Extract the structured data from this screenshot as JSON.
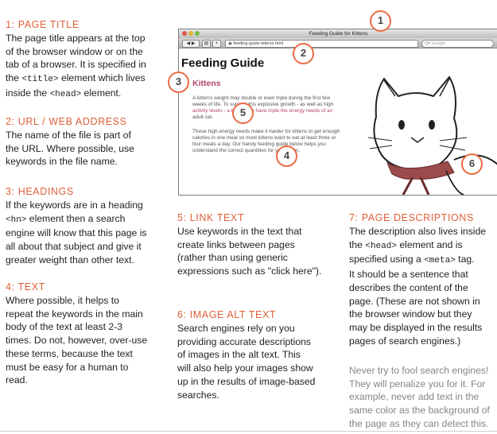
{
  "left": {
    "s1_heading": "1: PAGE TITLE",
    "s1_lines": [
      "The page title appears at the top",
      "of the browser window or on the",
      "tab of a browser. It is specified in"
    ],
    "s1_l4_pre": "the ",
    "s1_l4_code": "<title>",
    "s1_l4_post": " element which lives",
    "s1_l5_pre": "inside the ",
    "s1_l5_code": "<head>",
    "s1_l5_post": " element.",
    "s2_heading": "2: URL / WEB ADDRESS",
    "s2_lines": [
      "The name of the file is part of",
      "the URL. Where possible, use",
      "keywords in the file name."
    ],
    "s3_heading": "3: HEADINGS",
    "s3_l1": "If the keywords are in a heading",
    "s3_l2_code": "<hn>",
    "s3_l2_post": " element then a search",
    "s3_lines": [
      "engine will know that this page is",
      "all about that subject and give it",
      "greater weight than other text."
    ],
    "s4_heading": "4: TEXT",
    "s4_lines": [
      "Where possible, it helps to",
      "repeat the keywords in the main",
      "body of the text at least 2-3",
      "times. Do not, however, over-use",
      "these terms, because the text",
      "must be easy for a human to",
      "read."
    ]
  },
  "middle": {
    "s5_heading": "5: LINK TEXT",
    "s5_lines": [
      "Use keywords in the text that",
      "create links between pages",
      "(rather than using generic",
      "expressions such as \"click here\")."
    ],
    "s6_heading": "6: IMAGE ALT TEXT",
    "s6_lines": [
      "Search engines rely on you",
      "providing accurate descriptions",
      "of images in the alt text. This",
      "will also help your images show",
      "up in the results of image-based",
      "searches."
    ]
  },
  "right": {
    "s7_heading": "7: PAGE DESCRIPTIONS",
    "s7_l1": "The description also lives inside",
    "s7_l2_pre": "the ",
    "s7_l2_code": "<head>",
    "s7_l2_post": " element and is",
    "s7_l3_pre": "specified using a ",
    "s7_l3_code": "<meta>",
    "s7_l3_post": " tag.",
    "s7_lines": [
      "It should be a sentence that",
      "describes the content of the",
      "page. (These are not shown in",
      "the browser window but they",
      "may be displayed in the results",
      "pages of search engines.)"
    ],
    "note_lines": [
      "Never try to fool search engines!",
      "They will penalize you for it. For",
      "example, never add text in the",
      "same color as the background of",
      "the page as they can detect this."
    ]
  },
  "browser": {
    "window_title": "Feeding Guide for Kittens",
    "url": "feeding-guide-kittens.html",
    "search_placeholder": "Google",
    "page_heading": "Feeding Guide",
    "subheading": "Kittens",
    "para1_l1": "A kitten's weight may double or even triple during the first few",
    "para1_l2": "weeks of life. To support this explosive growth - as well as high",
    "para1_l3": "activity levels - a kitten may have triple the energy needs of an",
    "para1_l4": "adult cat.",
    "para2_l1": "These high energy needs make it harder for kittens to get enough",
    "para2_l2": "calories in one meal so most kittens want to eat at least three or",
    "para2_l3": "four meals a day. Our handy feeding guide below helps you",
    "para2_l4": "understand the correct quantities for your kitten."
  },
  "markers": [
    "1",
    "2",
    "3",
    "4",
    "5",
    "6"
  ],
  "colors": {
    "heading": "#e0603a",
    "marker_ring": "#ea6a43",
    "kittens_pink": "#b2456a",
    "note_grey": "#858585"
  }
}
